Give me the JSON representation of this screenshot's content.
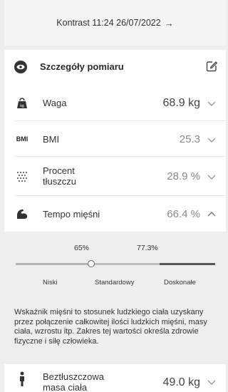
{
  "top_link": {
    "text": "Kontrast 11:24 26/07/2022",
    "arrow": "→"
  },
  "card": {
    "title": "Szczegóły pomiaru",
    "rows": [
      {
        "label": "Waga",
        "value": "68.9 kg",
        "icon": "kettlebell-icon"
      },
      {
        "label": "BMI",
        "value": "25.3",
        "icon_text": "BMI"
      },
      {
        "label_line1": "Procent",
        "label_line2": "tłuszczu",
        "value": "28.9 %",
        "icon": "dots-grid-icon"
      },
      {
        "label": "Tempo mięśni",
        "value": "66.4 %",
        "icon": "arm-muscle-icon"
      }
    ],
    "muscle_detail": {
      "threshold_low": "65%",
      "threshold_high": "77.3%",
      "current_value_percent": 66.4,
      "zones": [
        "Niski",
        "Standardowy",
        "Doskonałe"
      ],
      "description": "Wskaźnik mięśni to stosunek ludzkiego ciała uzyskany przez połączenie całkowitej ilości ludzkich mięśni, masy ciała, wzrostu itp. Zakres tej wartości określa zdrowie fizyczne i siłę człowieka."
    },
    "last_row": {
      "label_line1": "Beztłuszczowa",
      "label_line2": "masa ciała",
      "value": "49.0 kg",
      "icon": "person-icon"
    }
  }
}
